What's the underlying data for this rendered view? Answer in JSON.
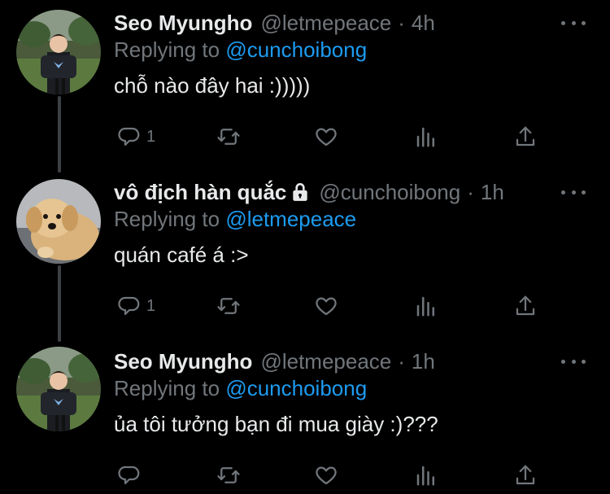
{
  "tweets": [
    {
      "name": "Seo Myungho",
      "handle": "@letmepeace",
      "separator": "·",
      "time": "4h",
      "reply_label": "Replying to",
      "reply_to": "@cunchoibong",
      "text": "chỗ nào đây hai :)))))",
      "reply_count": "1",
      "locked": false,
      "avatar": "person-photo"
    },
    {
      "name": "vô địch hàn quắc",
      "handle": "@cunchoibong",
      "separator": "·",
      "time": "1h",
      "reply_label": "Replying to",
      "reply_to": "@letmepeace",
      "text": "quán café á :>",
      "reply_count": "1",
      "locked": true,
      "avatar": "puppy-photo"
    },
    {
      "name": "Seo Myungho",
      "handle": "@letmepeace",
      "separator": "·",
      "time": "1h",
      "reply_label": "Replying to",
      "reply_to": "@cunchoibong",
      "text": "ủa tôi tưởng bạn đi mua giày :)???",
      "reply_count": "",
      "locked": false,
      "avatar": "person-photo"
    }
  ],
  "colors": {
    "background": "#000000",
    "text": "#e7e9ea",
    "muted": "#71767b",
    "link": "#1d9bf0",
    "thread_line": "#3e4144"
  },
  "icons": [
    "reply-icon",
    "retweet-icon",
    "like-icon",
    "analytics-icon",
    "share-icon",
    "more-icon",
    "lock-icon"
  ]
}
